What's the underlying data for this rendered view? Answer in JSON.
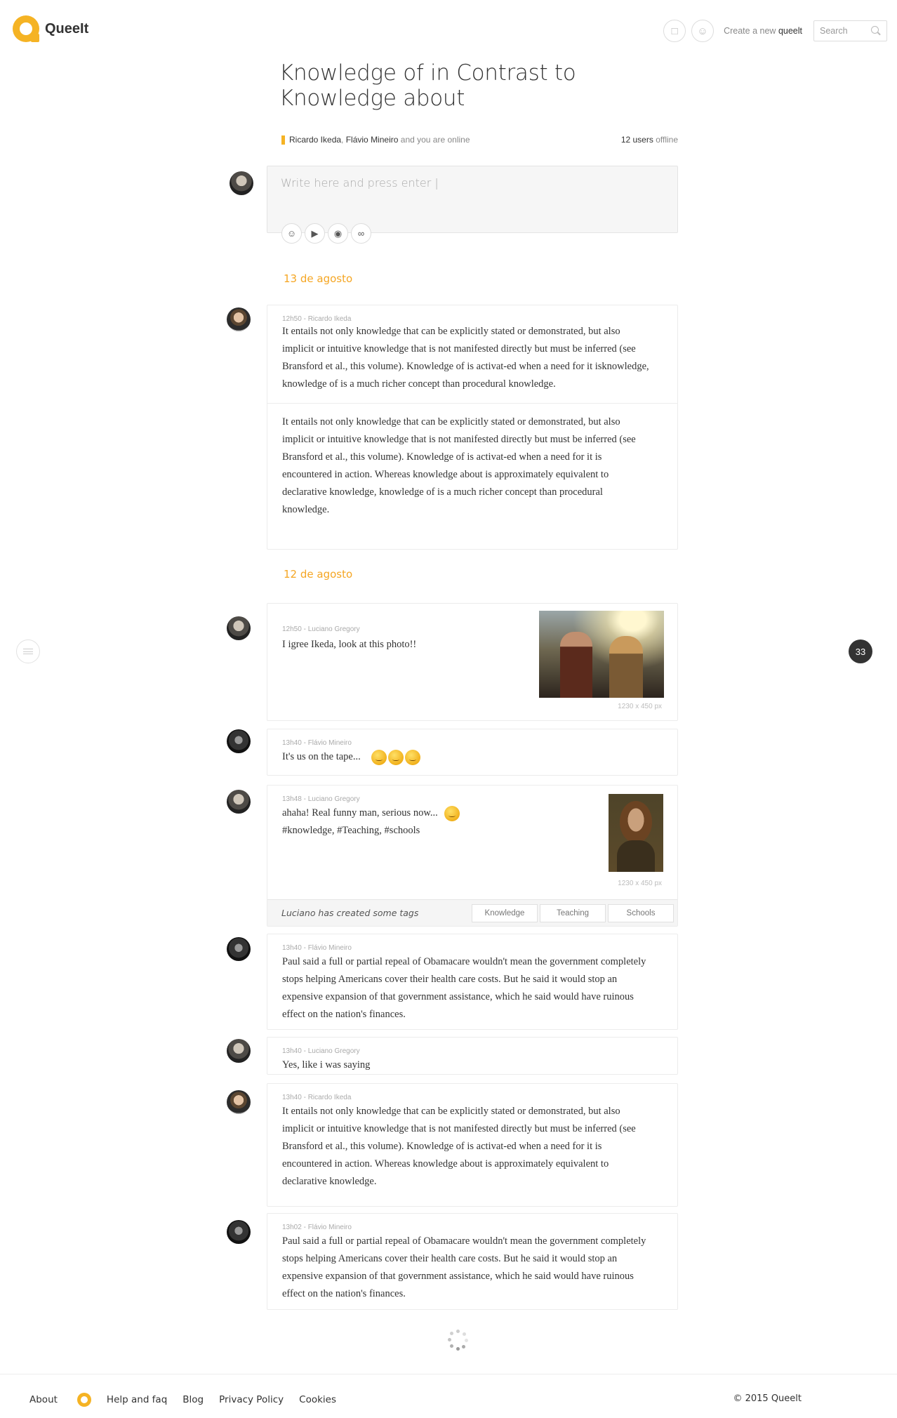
{
  "header": {
    "logo_text": "QueeIt",
    "create_label": "Create a new",
    "create_brand": "queelt",
    "search_placeholder": "Search"
  },
  "topic": {
    "title": "Knowledge of in Contrast to Knowledge about",
    "online_user_1": "Ricardo Ikeda",
    "online_user_2": "Flávio Mineiro",
    "online_suffix": "and you are online",
    "offline_count": "12 users",
    "offline_label": "offline"
  },
  "composer": {
    "placeholder": "Write here and press enter |",
    "tools": [
      "smiley-icon",
      "play-icon",
      "camera-icon",
      "link-icon"
    ]
  },
  "dates": {
    "first": "13 de agosto",
    "second": "12 de agosto"
  },
  "messages": [
    {
      "meta": "12h50 - Ricardo Ikeda",
      "text": "It entails not only knowledge that can be explicitly stated or demonstrated, but also implicit or intuitive knowledge that is not manifested directly but must be inferred (see Bransford et al., this volume). Knowledge of is activat-ed when a need for it isknowledge, knowledge of is a much richer concept than procedural knowledge.",
      "text2": "It entails not only knowledge that can be explicitly stated or demonstrated, but also implicit or intuitive knowledge that is not manifested directly but must be inferred (see Bransford et al., this volume). Knowledge of is activat-ed when a need for it is encountered in action. Whereas knowledge about is approximately equivalent to declarative knowledge, knowledge of is a much richer concept than procedural knowledge."
    },
    {
      "meta": "12h50 - Luciano Gregory",
      "text": "I igree Ikeda, look at this photo!!",
      "photo_size": "1230 x 450 px"
    },
    {
      "meta": "13h40 - Flávio Mineiro",
      "text": "It's us on the tape..."
    },
    {
      "meta": "13h48 - Luciano Gregory",
      "text": "ahaha! Real funny man, serious now...",
      "hashtags": "#knowledge, #Teaching, #schools",
      "photo_size": "1230 x 450 px",
      "tags_caption": "Luciano has created some tags",
      "tags": [
        "Knowledge",
        "Teaching",
        "Schools"
      ]
    },
    {
      "meta": "13h40 - Flávio Mineiro",
      "text": "Paul said a full or partial repeal of Obamacare wouldn't mean the government completely stops helping Americans cover their health care costs. But he said it would stop an expensive expansion of that government assistance, which he said would have ruinous effect on the nation's finances."
    },
    {
      "meta": "13h40 - Luciano Gregory",
      "text": "Yes, like i was saying"
    },
    {
      "meta": "13h40 - Ricardo Ikeda",
      "text": "It entails not only knowledge that can be explicitly stated or demonstrated, but also implicit or intuitive knowledge that is not manifested directly but must be inferred (see Bransford et al., this volume). Knowledge of is activat-ed when a need for it is encountered in action. Whereas knowledge about is approximately equivalent to declarative knowledge."
    },
    {
      "meta": "13h02 - Flávio Mineiro",
      "text": "Paul said a full or partial repeal of Obamacare wouldn't mean the government completely stops helping Americans cover their health care costs. But he said it would stop an expensive expansion of that government assistance, which he said would have ruinous effect on the nation's finances."
    }
  ],
  "side": {
    "counter": "33"
  },
  "footer": {
    "about": "About",
    "help": "Help and faq",
    "blog": "Blog",
    "privacy": "Privacy Policy",
    "cookies": "Cookies",
    "copyright": "© 2015 Queelt"
  },
  "colors": {
    "accent": "#f5b324",
    "date": "#f5a623"
  }
}
